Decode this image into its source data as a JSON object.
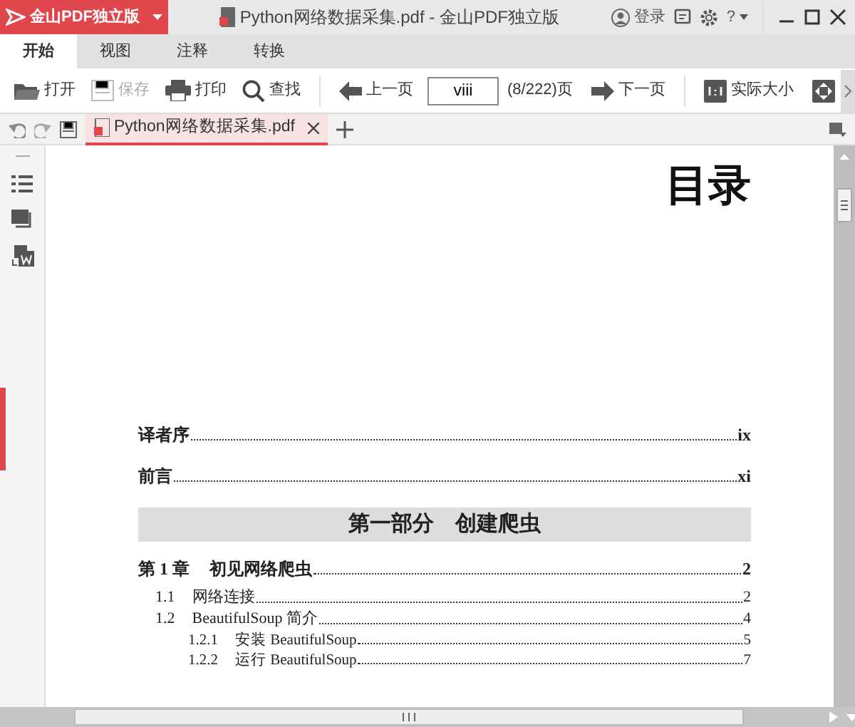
{
  "app_menu": {
    "label": "金山PDF独立版"
  },
  "window": {
    "title": "Python网络数据采集.pdf - 金山PDF独立版"
  },
  "account": {
    "label": "登录"
  },
  "help": {
    "label": "?"
  },
  "ribbon_tabs": [
    {
      "label": "开始",
      "selected": true
    },
    {
      "label": "视图",
      "selected": false
    },
    {
      "label": "注释",
      "selected": false
    },
    {
      "label": "转换",
      "selected": false
    }
  ],
  "toolbar": [
    {
      "kind": "button",
      "label": "打开",
      "disabled": false
    },
    {
      "kind": "button",
      "label": "保存",
      "disabled": true
    },
    {
      "kind": "button",
      "label": "打印",
      "disabled": false
    },
    {
      "kind": "button",
      "label": "查找",
      "disabled": false
    },
    {
      "kind": "separator"
    },
    {
      "kind": "button",
      "label": "上一页",
      "disabled": false
    },
    {
      "kind": "page-field",
      "value": "viii"
    },
    {
      "kind": "text",
      "label": "(8/222)页"
    },
    {
      "kind": "button",
      "label": "下一页",
      "disabled": false
    },
    {
      "kind": "separator"
    },
    {
      "kind": "button",
      "label": "实际大小",
      "disabled": false
    },
    {
      "kind": "icon-button"
    }
  ],
  "doc_tabs": [
    {
      "label": "Python网络数据采集.pdf",
      "selected": true
    }
  ],
  "document": {
    "heading": "目录",
    "toc": [
      {
        "kind": "entry",
        "label": "译者序",
        "page": "ix"
      },
      {
        "kind": "entry",
        "label": "前言",
        "page": "xi"
      },
      {
        "kind": "part",
        "label": "第一部分　创建爬虫"
      },
      {
        "kind": "entry",
        "number": "第 1 章",
        "label": "初见网络爬虫",
        "page": "2",
        "children": [
          {
            "kind": "entry",
            "number": "1.1",
            "label": "网络连接",
            "page": "2"
          },
          {
            "kind": "entry",
            "number": "1.2",
            "label": "BeautifulSoup 简介",
            "page": "4",
            "children": [
              {
                "kind": "entry",
                "number": "1.2.1",
                "label": "安装 BeautifulSoup",
                "page": "5"
              },
              {
                "kind": "entry",
                "number": "1.2.2",
                "label": "运行 BeautifulSoup",
                "page": "7"
              }
            ]
          }
        ]
      }
    ]
  }
}
